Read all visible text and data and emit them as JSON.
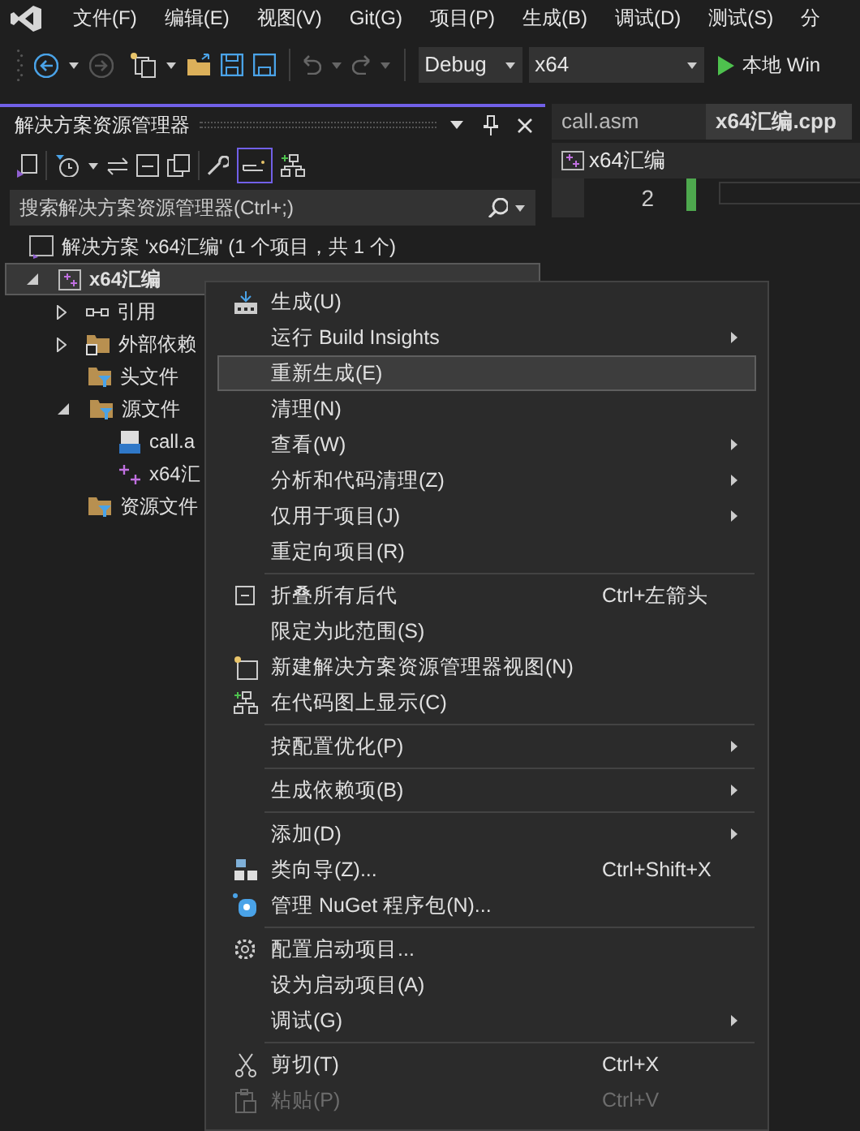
{
  "menu_bar": [
    {
      "label": "文件(F)"
    },
    {
      "label": "编辑(E)"
    },
    {
      "label": "视图(V)"
    },
    {
      "label": "Git(G)"
    },
    {
      "label": "项目(P)"
    },
    {
      "label": "生成(B)"
    },
    {
      "label": "调试(D)"
    },
    {
      "label": "测试(S)"
    },
    {
      "label": "分"
    }
  ],
  "toolbar": {
    "configuration": "Debug",
    "platform": "x64",
    "run_label": "本地 Win"
  },
  "solution_explorer": {
    "title": "解决方案资源管理器",
    "search": {
      "placeholder": "搜索解决方案资源管理器(Ctrl+;)"
    },
    "tree": [
      {
        "label": "解决方案 'x64汇编' (1 个项目，共 1 个)",
        "selected": false,
        "children": [
          {
            "label": "x64汇编",
            "bold": true,
            "selected": true,
            "expanded": true,
            "children": [
              {
                "label": "引用",
                "selected": false,
                "expanded": false
              },
              {
                "label": "外部依赖",
                "selected": false,
                "expanded": false
              },
              {
                "label": "头文件",
                "selected": false
              },
              {
                "label": "源文件",
                "selected": false,
                "expanded": true,
                "children": [
                  {
                    "label": "call.a",
                    "selected": false
                  },
                  {
                    "label": "x64汇",
                    "selected": false
                  }
                ]
              },
              {
                "label": "资源文件",
                "selected": false
              }
            ]
          }
        ]
      }
    ]
  },
  "editor": {
    "tabs": [
      {
        "label": "call.asm",
        "selected": false
      },
      {
        "label": "x64汇编.cpp",
        "selected": true
      }
    ],
    "nav_project": "x64汇编",
    "line_number": "2"
  },
  "context_menu": [
    {
      "kind": "item",
      "label": "生成(U)",
      "selected": false
    },
    {
      "kind": "item",
      "label": "运行 Build Insights",
      "submenu": true,
      "selected": false
    },
    {
      "kind": "item",
      "label": "重新生成(E)",
      "selected": true
    },
    {
      "kind": "item",
      "label": "清理(N)",
      "selected": false
    },
    {
      "kind": "item",
      "label": "查看(W)",
      "submenu": true,
      "selected": false
    },
    {
      "kind": "item",
      "label": "分析和代码清理(Z)",
      "submenu": true,
      "selected": false
    },
    {
      "kind": "item",
      "label": "仅用于项目(J)",
      "submenu": true,
      "selected": false
    },
    {
      "kind": "item",
      "label": "重定向项目(R)",
      "selected": false
    },
    {
      "kind": "separator"
    },
    {
      "kind": "item",
      "label": "折叠所有后代",
      "shortcut": "Ctrl+左箭头",
      "selected": false
    },
    {
      "kind": "item",
      "label": "限定为此范围(S)",
      "selected": false
    },
    {
      "kind": "item",
      "label": "新建解决方案资源管理器视图(N)",
      "selected": false
    },
    {
      "kind": "item",
      "label": "在代码图上显示(C)",
      "selected": false
    },
    {
      "kind": "separator"
    },
    {
      "kind": "item",
      "label": "按配置优化(P)",
      "submenu": true,
      "selected": false
    },
    {
      "kind": "separator"
    },
    {
      "kind": "item",
      "label": "生成依赖项(B)",
      "submenu": true,
      "selected": false
    },
    {
      "kind": "separator"
    },
    {
      "kind": "item",
      "label": "添加(D)",
      "submenu": true,
      "selected": false
    },
    {
      "kind": "item",
      "label": "类向导(Z)...",
      "shortcut": "Ctrl+Shift+X",
      "selected": false
    },
    {
      "kind": "item",
      "label": "管理 NuGet 程序包(N)...",
      "selected": false
    },
    {
      "kind": "separator"
    },
    {
      "kind": "item",
      "label": "配置启动项目...",
      "selected": false
    },
    {
      "kind": "item",
      "label": "设为启动项目(A)",
      "selected": false
    },
    {
      "kind": "item",
      "label": "调试(G)",
      "submenu": true,
      "selected": false
    },
    {
      "kind": "separator"
    },
    {
      "kind": "item",
      "label": "剪切(T)",
      "shortcut": "Ctrl+X",
      "selected": false
    },
    {
      "kind": "item",
      "label": "粘贴(P)",
      "shortcut": "Ctrl+V",
      "disabled": true,
      "selected": false
    }
  ]
}
